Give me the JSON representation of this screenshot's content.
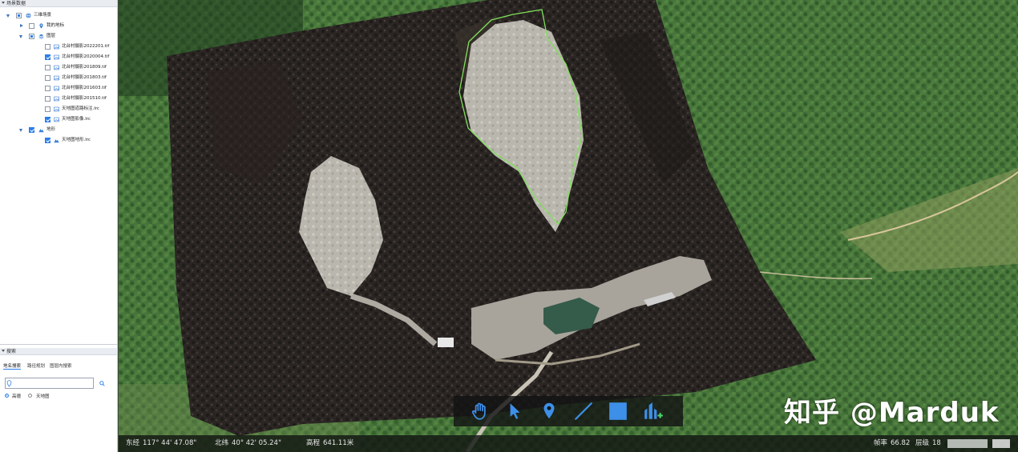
{
  "left_panel": {
    "header": "场景数据",
    "tree": [
      {
        "label": "三维场景",
        "icon": "globe-icon",
        "checked": "partial"
      },
      {
        "label": "我的地标",
        "icon": "pin-icon",
        "checked": "unchecked"
      },
      {
        "label": "图层",
        "icon": "layers-icon",
        "checked": "partial"
      },
      {
        "label": "北台村摄影2022201.tif",
        "icon": "image-icon",
        "checked": "unchecked"
      },
      {
        "label": "北台村摄影2020004.tif",
        "icon": "image-icon",
        "checked": "checked"
      },
      {
        "label": "北台村摄影201809.tif",
        "icon": "image-icon",
        "checked": "unchecked"
      },
      {
        "label": "北台村摄影201803.tif",
        "icon": "image-icon",
        "checked": "unchecked"
      },
      {
        "label": "北台村摄影201603.tif",
        "icon": "image-icon",
        "checked": "unchecked"
      },
      {
        "label": "北台村摄影201510.tif",
        "icon": "image-icon",
        "checked": "unchecked"
      },
      {
        "label": "天地图道路标注.lrc",
        "icon": "image-icon",
        "checked": "unchecked"
      },
      {
        "label": "天地图影像.lrc",
        "icon": "image-icon",
        "checked": "checked"
      },
      {
        "label": "地形",
        "icon": "terrain-icon",
        "checked": "checked"
      },
      {
        "label": "天地图地形.lrc",
        "icon": "terrain-icon",
        "checked": "checked"
      }
    ],
    "search": {
      "header": "搜索",
      "tabs": [
        "地名搜索",
        "路径规划",
        "图层内搜索"
      ],
      "input_value": "",
      "input_placeholder": "",
      "sources": [
        "高德",
        "天地图"
      ],
      "selected_source": "高德"
    }
  },
  "toolbar": {
    "tools": [
      "hand-icon",
      "select-arrow-icon",
      "placemark-icon",
      "line-icon",
      "polygon-icon",
      "terrain-analysis-icon"
    ]
  },
  "watermark": "知乎 @Marduk",
  "status_bar": {
    "longitude_label": "东经",
    "longitude": "117° 44' 47.08\"",
    "latitude_label": "北纬",
    "latitude": "40° 42' 05.24\"",
    "elevation_label": "高程",
    "elevation": "641.11米",
    "fps_label": "帧率",
    "fps": "66.82",
    "level_label": "层级",
    "level": "18"
  },
  "colors": {
    "accent": "#2a7ee8",
    "highlight_outline": "#7fe05a",
    "toolbar_icon": "#3d8fe8"
  }
}
